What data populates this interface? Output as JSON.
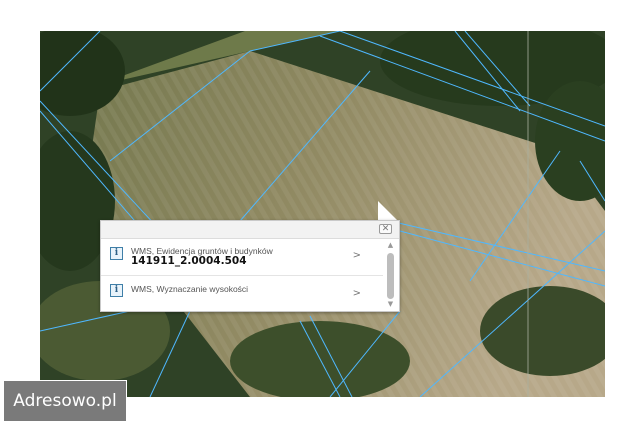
{
  "popup": {
    "close_symbol": "✕",
    "rows": [
      {
        "title": "WMS, Ewidencja gruntów i budynków",
        "value": "141911_2.0004.504",
        "chevron": ">"
      },
      {
        "title": "WMS, Wyznaczanie wysokości",
        "chevron": ">"
      }
    ],
    "info_glyph": "i",
    "scroll_up": "▲",
    "scroll_down": "▼"
  },
  "watermark": {
    "text": "Adresowo.pl"
  },
  "colors": {
    "parcel_lines": "#4fb8ff",
    "field_light": "#b9a98a",
    "field_mid": "#8c8a5e",
    "forest": "#22331c"
  },
  "icons": {
    "info": "info-icon",
    "close": "close-icon",
    "chevron": "chevron-right-icon"
  }
}
